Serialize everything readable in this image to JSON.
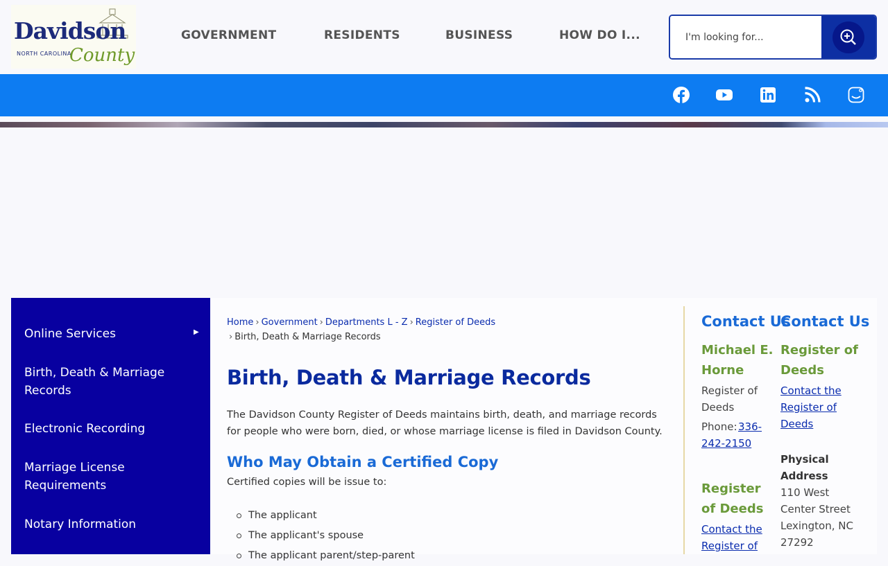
{
  "logo": {
    "name": "Davidson",
    "state": "NORTH CAROLINA",
    "county": "County"
  },
  "nav": [
    "GOVERNMENT",
    "RESIDENTS",
    "BUSINESS",
    "HOW DO I..."
  ],
  "search": {
    "placeholder": "I'm looking for..."
  },
  "social": [
    "facebook-icon",
    "youtube-icon",
    "linkedin-icon",
    "rss-icon",
    "instagram-icon"
  ],
  "colors": {
    "brand_blue": "#0d7cf2",
    "navy": "#0800a0",
    "heading": "#0a2a9e",
    "accent_green": "#6a9a3a"
  },
  "sidebar": {
    "items": [
      "Online Services",
      "Birth, Death & Marriage Records",
      "Electronic Recording",
      "Marriage License Requirements",
      "Notary Information"
    ]
  },
  "breadcrumb": {
    "items": [
      "Home",
      "Government",
      "Departments L - Z",
      "Register of Deeds"
    ],
    "current": "Birth, Death & Marriage Records"
  },
  "main": {
    "title": "Birth, Death & Marriage Records",
    "intro": "The Davidson County Register of Deeds maintains birth, death, and marriage records for people who were born, died, or whose marriage license is filed in Davidson County.",
    "subheading": "Who May Obtain a Certified Copy",
    "subtext": "Certified copies will be issue to:",
    "list": [
      "The applicant",
      "The applicant's spouse",
      "The applicant parent/step-parent"
    ]
  },
  "contact": {
    "heading1": "Contact Us",
    "heading2": "Contact Us",
    "col1": {
      "name": "Michael E. Horne",
      "role": "Register of Deeds",
      "phone_label": "Phone:",
      "phone": "336-242-2150",
      "name2": "Register of Deeds",
      "link": "Contact the Register of"
    },
    "col2": {
      "name": "Register of Deeds",
      "link": "Contact the Register of Deeds",
      "address_label": "Physical Address",
      "address": "110 West Center Street Lexington, NC 27292"
    }
  }
}
